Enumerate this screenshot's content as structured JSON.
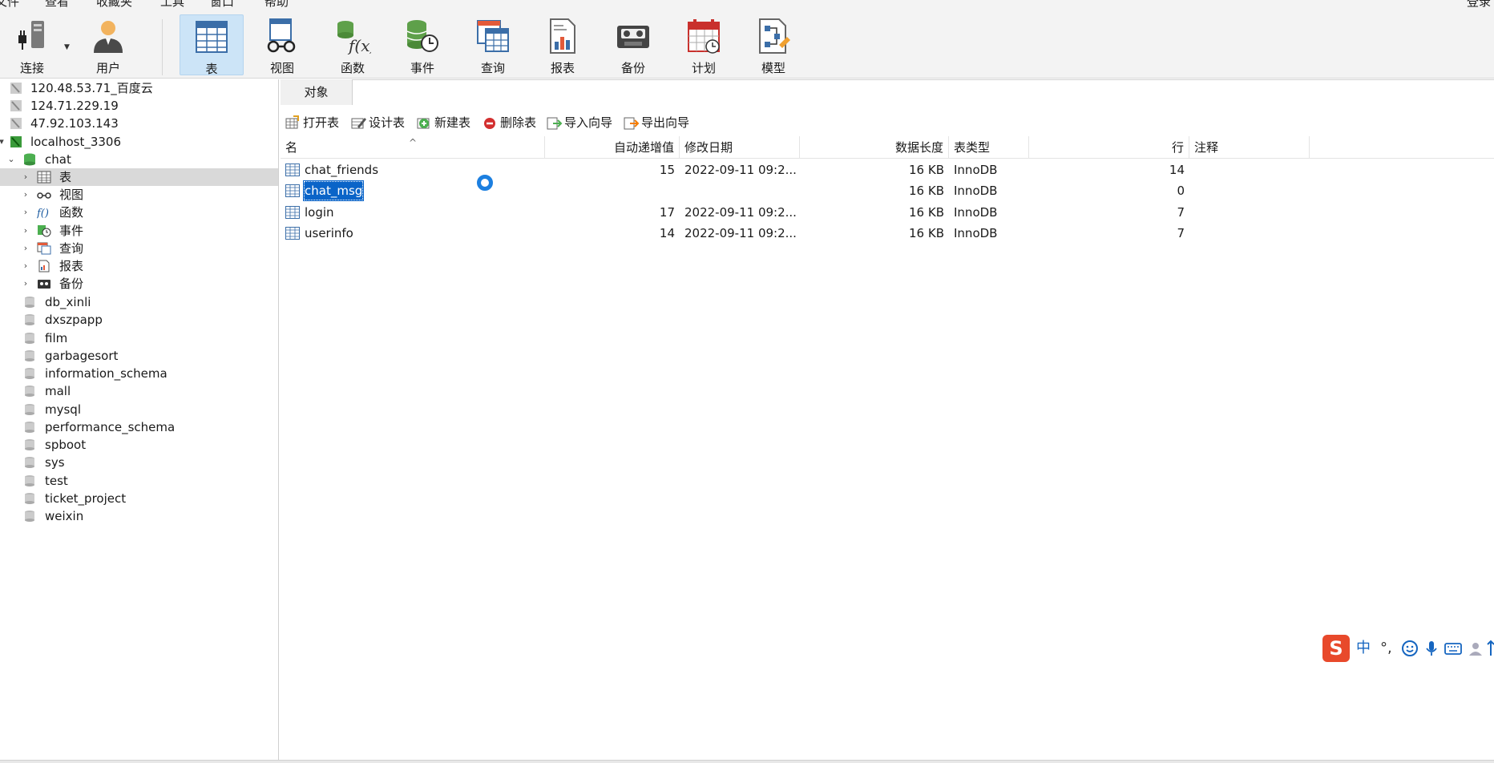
{
  "menubar": {
    "items": [
      "文件",
      "查看",
      "收藏夹",
      "工具",
      "窗口",
      "帮助"
    ],
    "right": "登录"
  },
  "toolbar": {
    "buttons": [
      {
        "label": "连接",
        "icon": "connection-plug-icon"
      },
      {
        "label": "用户",
        "icon": "user-icon"
      },
      {
        "label": "表",
        "icon": "table-icon",
        "active": true
      },
      {
        "label": "视图",
        "icon": "view-glasses-icon"
      },
      {
        "label": "函数",
        "icon": "function-icon"
      },
      {
        "label": "事件",
        "icon": "event-clock-icon"
      },
      {
        "label": "查询",
        "icon": "query-icon"
      },
      {
        "label": "报表",
        "icon": "report-icon"
      },
      {
        "label": "备份",
        "icon": "backup-tape-icon"
      },
      {
        "label": "计划",
        "icon": "calendar-icon"
      },
      {
        "label": "模型",
        "icon": "model-icon"
      }
    ]
  },
  "tree": {
    "connections": [
      "120.48.53.71_百度云",
      "124.71.229.19",
      "47.92.103.143",
      "localhost_3306"
    ],
    "open_db": "chat",
    "children": [
      "表",
      "视图",
      "函数",
      "事件",
      "查询",
      "报表",
      "备份"
    ],
    "databases": [
      "db_xinli",
      "dxszpapp",
      "film",
      "garbagesort",
      "information_schema",
      "mall",
      "mysql",
      "performance_schema",
      "spboot",
      "sys",
      "test",
      "ticket_project",
      "weixin"
    ]
  },
  "tabs": {
    "objects": "对象"
  },
  "objbar": {
    "open": "打开表",
    "design": "设计表",
    "new": "新建表",
    "delete": "删除表",
    "import": "导入向导",
    "export": "导出向导"
  },
  "table": {
    "headers": {
      "name": "名",
      "auto_inc": "自动递增值",
      "modified": "修改日期",
      "data_len": "数据长度",
      "engine": "表类型",
      "rows": "行",
      "comment": "注释"
    },
    "rows": [
      {
        "name": "chat_friends",
        "auto_inc": "15",
        "modified": "2022-09-11 09:2...",
        "data_len": "16 KB",
        "engine": "InnoDB",
        "rows": "14",
        "comment": ""
      },
      {
        "name": "chat_msg",
        "auto_inc": "",
        "modified": "",
        "data_len": "16 KB",
        "engine": "InnoDB",
        "rows": "0",
        "comment": "",
        "selected": true
      },
      {
        "name": "login",
        "auto_inc": "17",
        "modified": "2022-09-11 09:2...",
        "data_len": "16 KB",
        "engine": "InnoDB",
        "rows": "7",
        "comment": ""
      },
      {
        "name": "userinfo",
        "auto_inc": "14",
        "modified": "2022-09-11 09:2...",
        "data_len": "16 KB",
        "engine": "InnoDB",
        "rows": "7",
        "comment": ""
      }
    ]
  },
  "ime": {
    "logo": "S",
    "mode": "中",
    "punct": "°,"
  },
  "colors": {
    "accent": "#0a64c8",
    "active_tab": "#cce4f7",
    "ime_logo": "#e8492b"
  }
}
